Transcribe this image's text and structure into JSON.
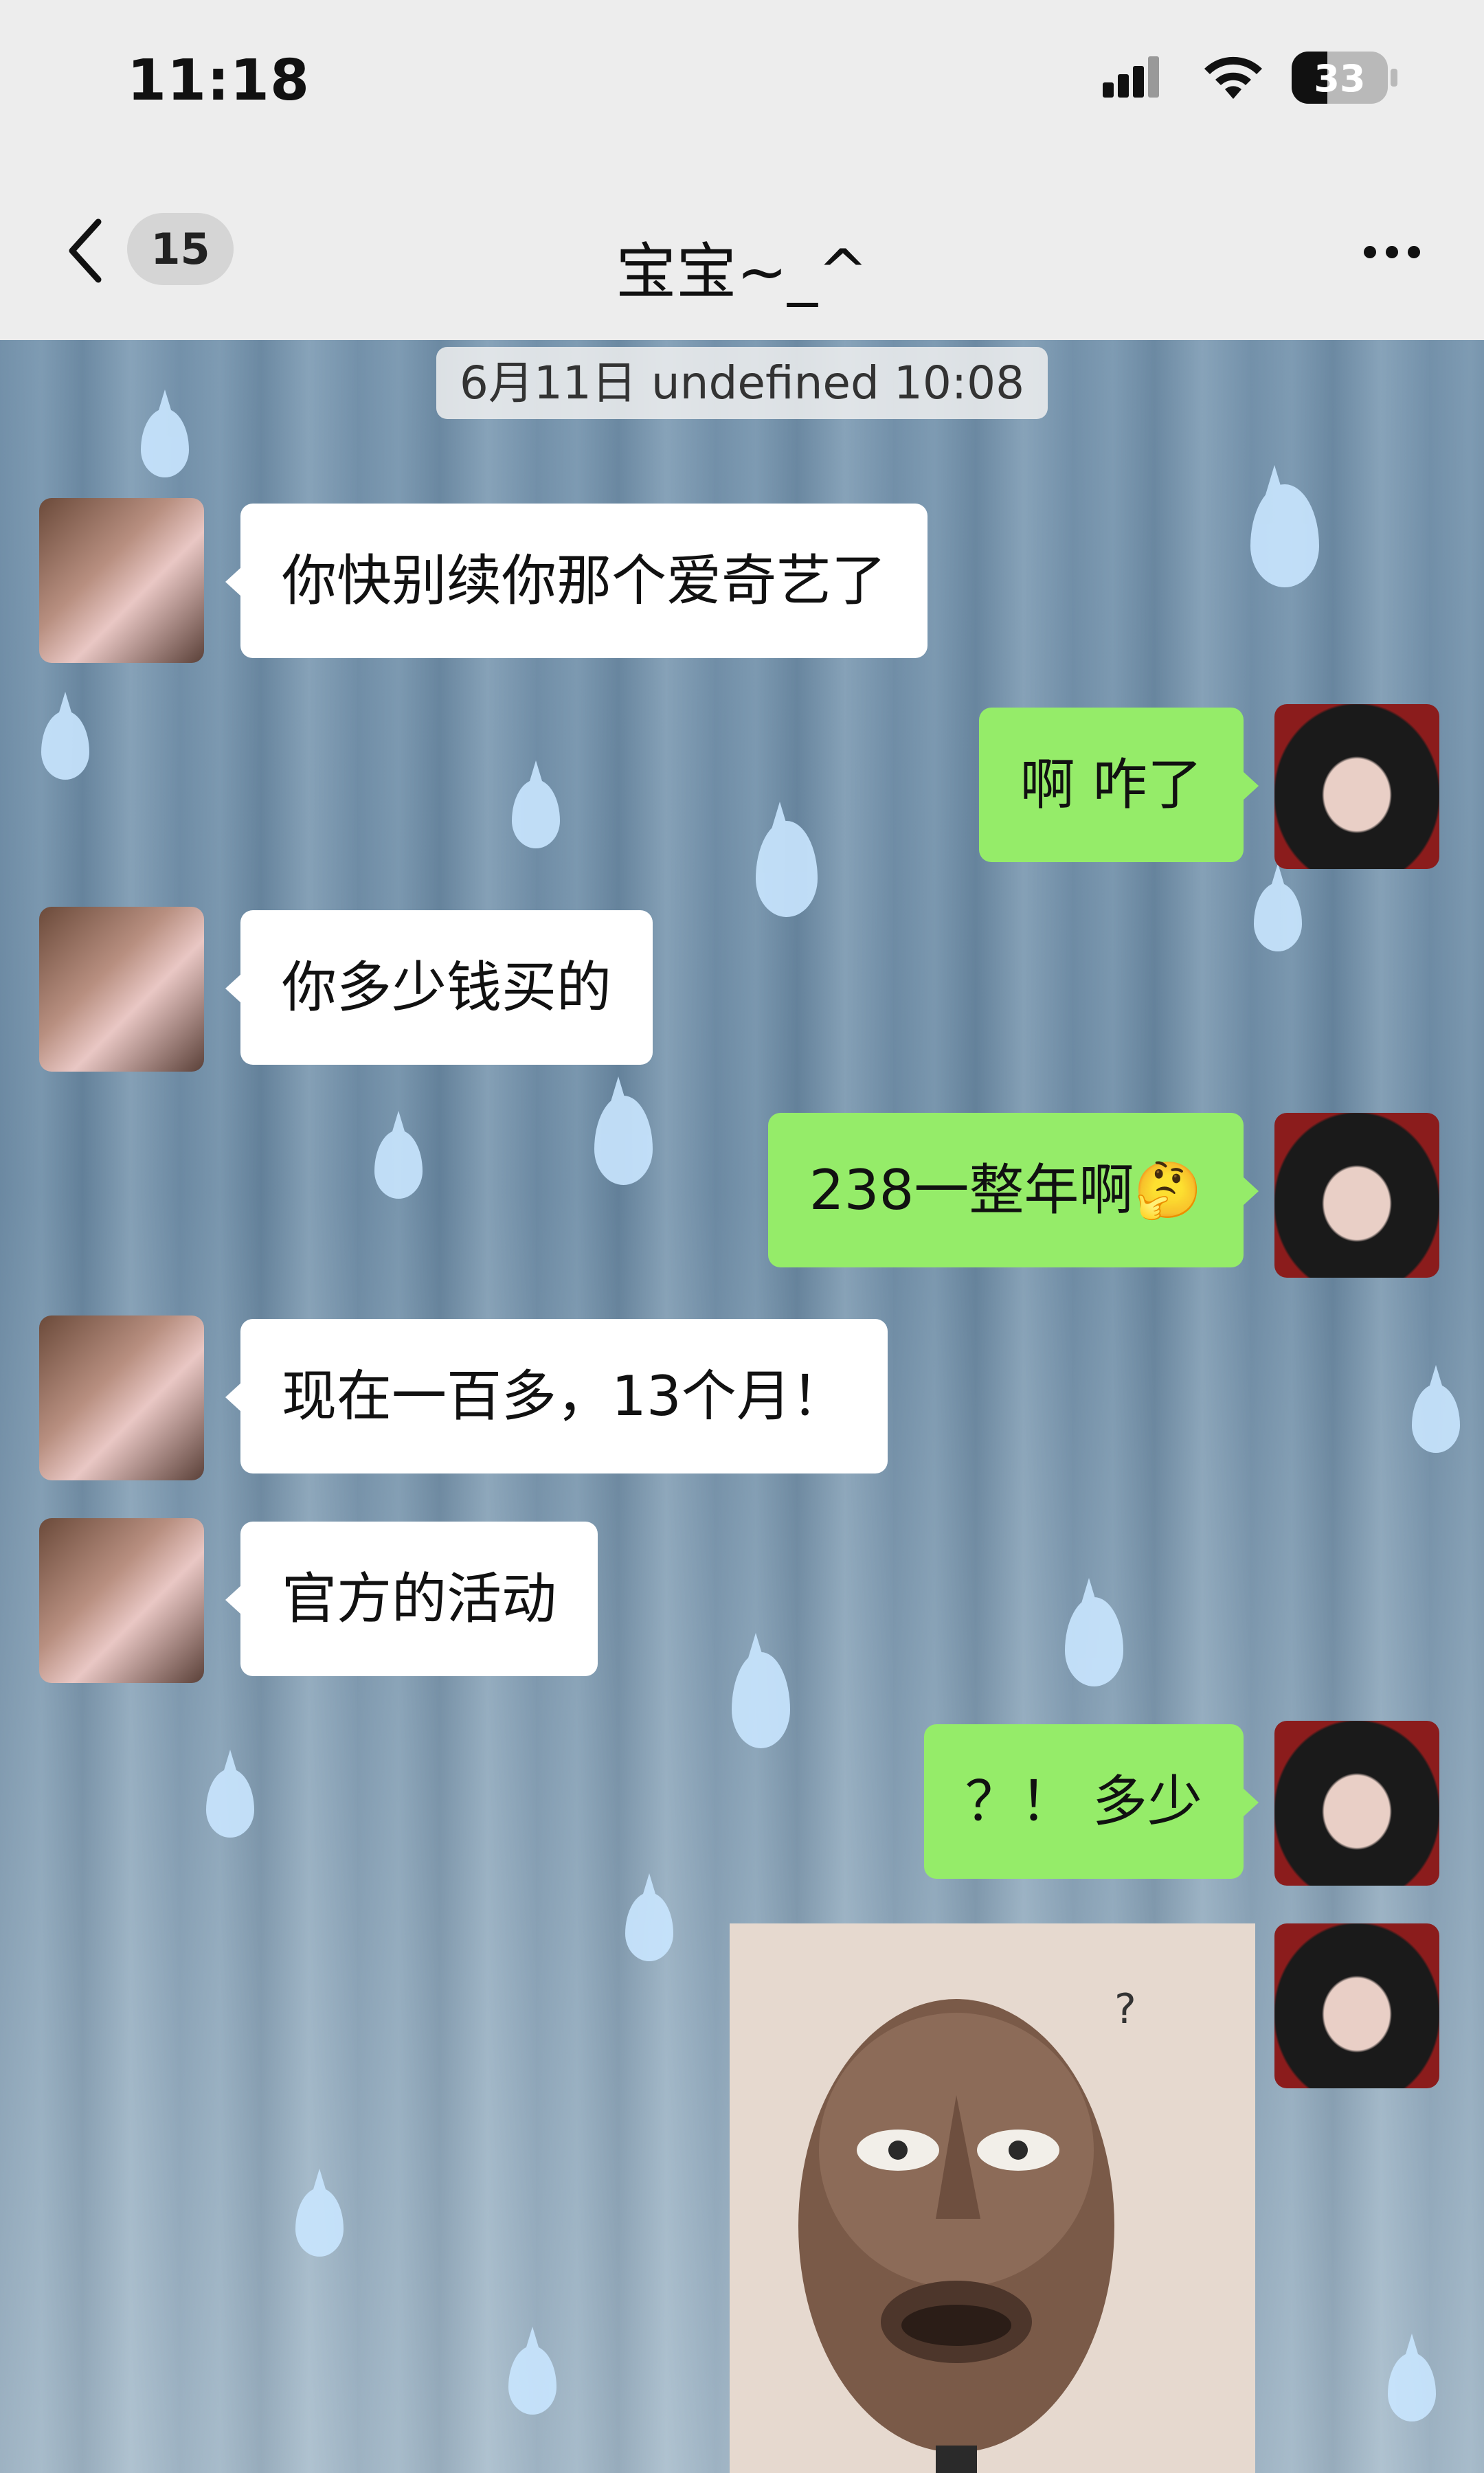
{
  "status_bar": {
    "time": "11:18",
    "battery": "33"
  },
  "nav": {
    "back_count": "15",
    "title": "宝宝~_^"
  },
  "chat": {
    "timestamp": "6月11日 undefined 10:08",
    "messages": [
      {
        "from": "them",
        "text": "你快别续你那个爱奇艺了"
      },
      {
        "from": "me",
        "text": "啊 咋了"
      },
      {
        "from": "them",
        "text": "你多少钱买的"
      },
      {
        "from": "me",
        "text": "238一整年啊🤔"
      },
      {
        "from": "them",
        "text": "现在一百多，13个月！"
      },
      {
        "from": "them",
        "text": "官方的活动"
      },
      {
        "from": "me",
        "text": "？！ 多少"
      }
    ],
    "sticker": {
      "caption": "?"
    }
  },
  "colors": {
    "me_bubble": "#95ec69",
    "them_bubble": "#ffffff",
    "bar": "#ededed"
  }
}
